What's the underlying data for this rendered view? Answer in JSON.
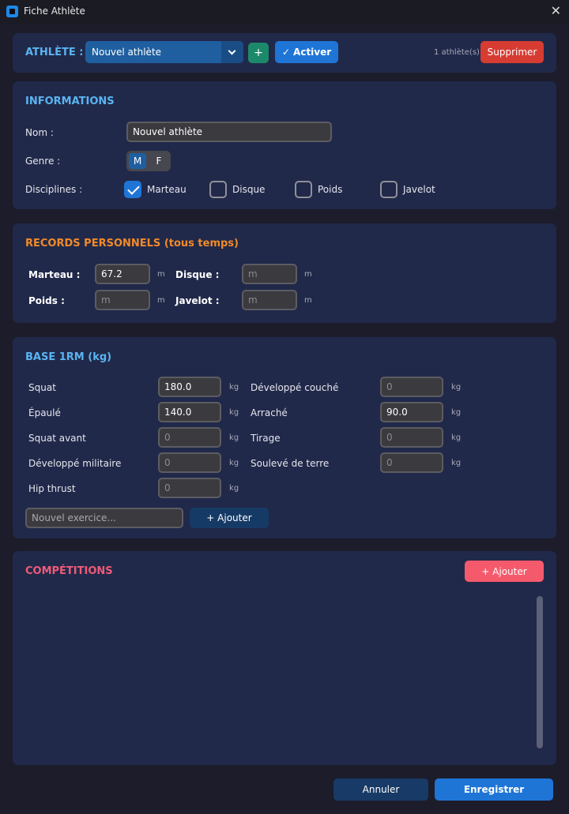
{
  "window": {
    "title": "Fiche Athlète"
  },
  "athlete_bar": {
    "label": "ATHLÈTE :",
    "selected": "Nouvel athlète",
    "add_label": "+",
    "activate_label": "✓ Activer",
    "count": "1 athlète(s)",
    "delete_label": "Supprimer"
  },
  "info": {
    "title": "INFORMATIONS",
    "name_label": "Nom :",
    "name_value": "Nouvel athlète",
    "gender_label": "Genre :",
    "gender_m": "M",
    "gender_f": "F",
    "gender_selected": "M",
    "disciplines_label": "Disciplines :",
    "disciplines": [
      {
        "label": "Marteau",
        "checked": true
      },
      {
        "label": "Disque",
        "checked": false
      },
      {
        "label": "Poids",
        "checked": false
      },
      {
        "label": "Javelot",
        "checked": false
      }
    ]
  },
  "records": {
    "title": "RECORDS PERSONNELS (tous temps)",
    "unit": "m",
    "items": [
      {
        "label": "Marteau :",
        "value": "67.2",
        "placeholder": "m"
      },
      {
        "label": "Disque :",
        "value": "",
        "placeholder": "m"
      },
      {
        "label": "Poids :",
        "value": "",
        "placeholder": "m"
      },
      {
        "label": "Javelot :",
        "value": "",
        "placeholder": "m"
      }
    ]
  },
  "base": {
    "title": "BASE 1RM (kg)",
    "unit": "kg",
    "exercises": [
      {
        "label": "Squat",
        "value": "180.0",
        "placeholder": "0"
      },
      {
        "label": "Développé couché",
        "value": "",
        "placeholder": "0"
      },
      {
        "label": "Épaulé",
        "value": "140.0",
        "placeholder": "0"
      },
      {
        "label": "Arraché",
        "value": "90.0",
        "placeholder": "0"
      },
      {
        "label": "Squat avant",
        "value": "",
        "placeholder": "0"
      },
      {
        "label": "Tirage",
        "value": "",
        "placeholder": "0"
      },
      {
        "label": "Développé militaire",
        "value": "",
        "placeholder": "0"
      },
      {
        "label": "Soulevé de terre",
        "value": "",
        "placeholder": "0"
      },
      {
        "label": "Hip thrust",
        "value": "",
        "placeholder": "0"
      }
    ],
    "new_exercise_placeholder": "Nouvel exercice...",
    "add_label": "+ Ajouter"
  },
  "competitions": {
    "title": "COMPÉTITIONS",
    "add_label": "+ Ajouter"
  },
  "footer": {
    "cancel_label": "Annuler",
    "save_label": "Enregistrer"
  },
  "colors": {
    "accent": "#1f75d6",
    "danger": "#d63c32",
    "section_blue": "#5ab4f2",
    "section_orange": "#f08a2a",
    "section_pink": "#f05a78"
  }
}
